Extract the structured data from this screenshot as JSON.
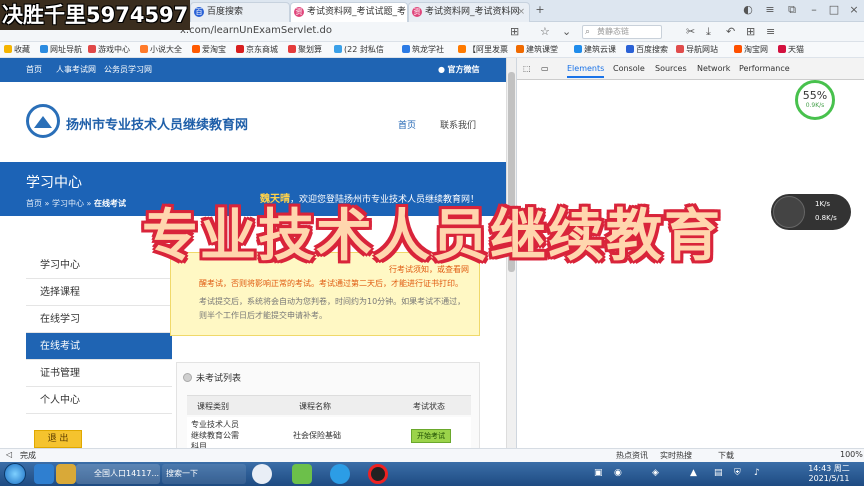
{
  "overlay": {
    "corner_title": "决胜千里5974597",
    "big_title": "专业技术人员继续教育"
  },
  "browser": {
    "tabs": [
      {
        "label": "百度搜索"
      },
      {
        "label": "考试资料网_考试试题_考"
      },
      {
        "label": "考试资料网_考试资料网"
      }
    ],
    "url": "x.com/learnUnExamServlet.do",
    "search_placeholder": "黄静态链",
    "bookmarks": [
      {
        "label": "收藏",
        "color": "#f5b400"
      },
      {
        "label": "网址导航",
        "color": "#2b8be0"
      },
      {
        "label": "游戏中心",
        "color": "#e04848"
      },
      {
        "label": "小说大全",
        "color": "#ff7a2a"
      },
      {
        "label": "爱淘宝",
        "color": "#ff5a00"
      },
      {
        "label": "京东商城",
        "color": "#d81e1e"
      },
      {
        "label": "聚划算",
        "color": "#e43b3b"
      },
      {
        "label": "(22 封私信",
        "color": "#3aa0e8"
      },
      {
        "label": "筑龙学社",
        "color": "#2c7be5"
      },
      {
        "label": "【阿里发票",
        "color": "#ff7a00"
      },
      {
        "label": "建筑课堂",
        "color": "#f06a00"
      },
      {
        "label": "建筑云课",
        "color": "#1f8ceb"
      },
      {
        "label": "百度搜索",
        "color": "#2a61d6"
      },
      {
        "label": "导航网站",
        "color": "#e04c4c"
      },
      {
        "label": "淘宝网",
        "color": "#ff5000"
      },
      {
        "label": "天猫",
        "color": "#d3113f"
      }
    ]
  },
  "site": {
    "topnav": [
      "首页",
      "人事考试网",
      "公务员学习网"
    ],
    "wechat": "官方微信",
    "name": "扬州市专业技术人员继续教育网",
    "nav": [
      "首页",
      "联系我们"
    ],
    "banner_title": "学习中心",
    "breadcrumb": {
      "home": "首页",
      "sep1": "»",
      "mid": "学习中心",
      "sep2": "»",
      "current": "在线考试"
    },
    "welcome_name": "魏天晴",
    "welcome_text": "，欢迎您登陆扬州市专业技术人员继续教育网！",
    "sidebar": [
      "学习中心",
      "选择课程",
      "在线学习",
      "在线考试",
      "证书管理",
      "个人中心"
    ],
    "logout": "退 出",
    "notice_line1": "行考试须知，或查看网",
    "notice_line2": "醒考试，否则将影响正常的考试。考试通过第二天后，才能进行证书打印。",
    "notice_line3": "考试提交后，系统将会自动为您判卷，时间约为10分钟。如果考试不通过，则半个工作日后才能提交申请补考。",
    "exam_list_title": "未考试列表",
    "table_headers": [
      "课程类别",
      "课程名称",
      "考试状态"
    ],
    "rows": [
      {
        "category": "专业技术人员继续教育公需科目",
        "course": "社会保险基础",
        "action": "开始考试"
      }
    ]
  },
  "devtools": {
    "tabs": [
      "Elements",
      "Console",
      "Sources",
      "Network",
      "Performance"
    ],
    "gauge_value": "55%",
    "gauge_sub": "0.9K/s",
    "net_up": "1K/s",
    "net_down": "0.8K/s"
  },
  "statusbar": {
    "left": "完成",
    "items": [
      "热点资讯",
      "实时热搜",
      "下载",
      "100%"
    ]
  },
  "taskbar": {
    "item1": "全国人口14117...",
    "item2": "搜索一下",
    "time": "14:43 周二",
    "date": "2021/5/11"
  }
}
